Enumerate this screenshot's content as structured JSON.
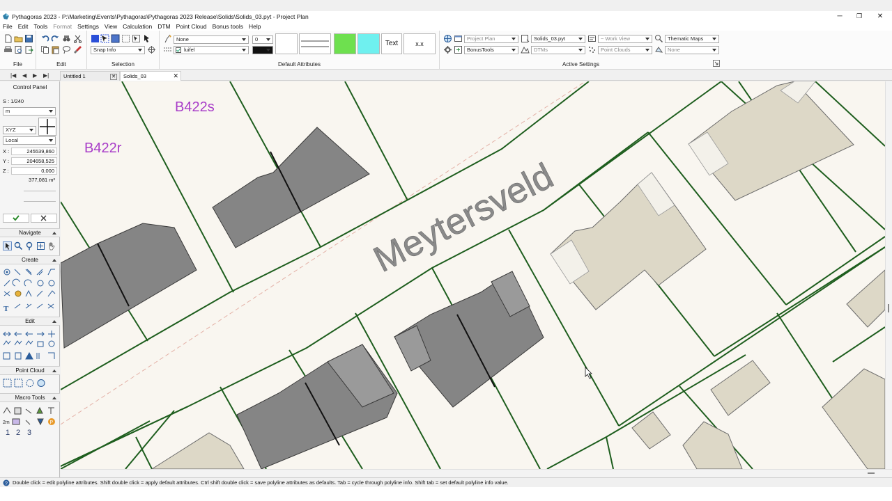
{
  "window": {
    "title": "Pythagoras 2023 - P:\\Marketing\\Events\\Pythagoras\\Pythagoras 2023 Release\\Solids\\Solids_03.pyt - Project Plan",
    "minimize": "─",
    "maximize": "❐",
    "close": "✕"
  },
  "menu": [
    "File",
    "Edit",
    "Tools",
    "Format",
    "Settings",
    "View",
    "Calculation",
    "DTM",
    "Point Cloud",
    "Bonus tools",
    "Help"
  ],
  "ribbon": {
    "groups": {
      "file": "File",
      "edit": "Edit",
      "selection": "Selection",
      "default_attributes": "Default Attributes",
      "active_settings": "Active Settings"
    },
    "snap_info": "Snap Info",
    "attributes": {
      "layer_value": "None",
      "linetype_value": "luifel",
      "width_value": "0",
      "text_button": "Text",
      "number_button": "x.x",
      "colors": {
        "green": "#6ee04f",
        "cyan": "#6ff0ef",
        "black": "#111111"
      }
    },
    "active": {
      "project_plan": "Project Plan",
      "bonus_tools": "BonusTools",
      "document": "Solids_03.pyt",
      "dtms": "DTMs",
      "work_view": "~ Work View",
      "point_clouds": "Point Clouds",
      "thematic_maps": "Thematic Maps",
      "none": "None"
    }
  },
  "tabs": [
    {
      "label": "Untitled 1"
    },
    {
      "label": "Solids_03",
      "active": true
    }
  ],
  "control_panel": {
    "title": "Control Panel",
    "scale": "S : 1/240",
    "unit": "m",
    "coord_system": "XYZ",
    "reference": "Local",
    "x_label": "X :",
    "x_value": "245539,860",
    "y_label": "Y :",
    "y_value": "204658,525",
    "z_label": "Z :",
    "z_value": "0,000",
    "area_value": "377,081 m²",
    "sections": [
      "Navigate",
      "Create",
      "Edit",
      "Point Cloud",
      "Macro Tools"
    ],
    "macro_numbers": [
      "1",
      "2",
      "3"
    ]
  },
  "map": {
    "street_name": "Meytersveld",
    "parcel_labels": [
      "B422r",
      "B422s"
    ],
    "colors": {
      "background": "#f9f6f0",
      "parcel_line": "#1e5e1e",
      "building_dark": "#858585",
      "building_light": "#ddd8c7",
      "label_purple": "#a83cc8",
      "street_text": "#8a8a8a"
    }
  },
  "status": {
    "hint": "Double click = edit polyline attributes. Shift double click = apply default attributes. Ctrl shift double click = save polyline attributes as defaults. Tab = cycle through polyline info. Shift tab = set default polyline info value."
  }
}
